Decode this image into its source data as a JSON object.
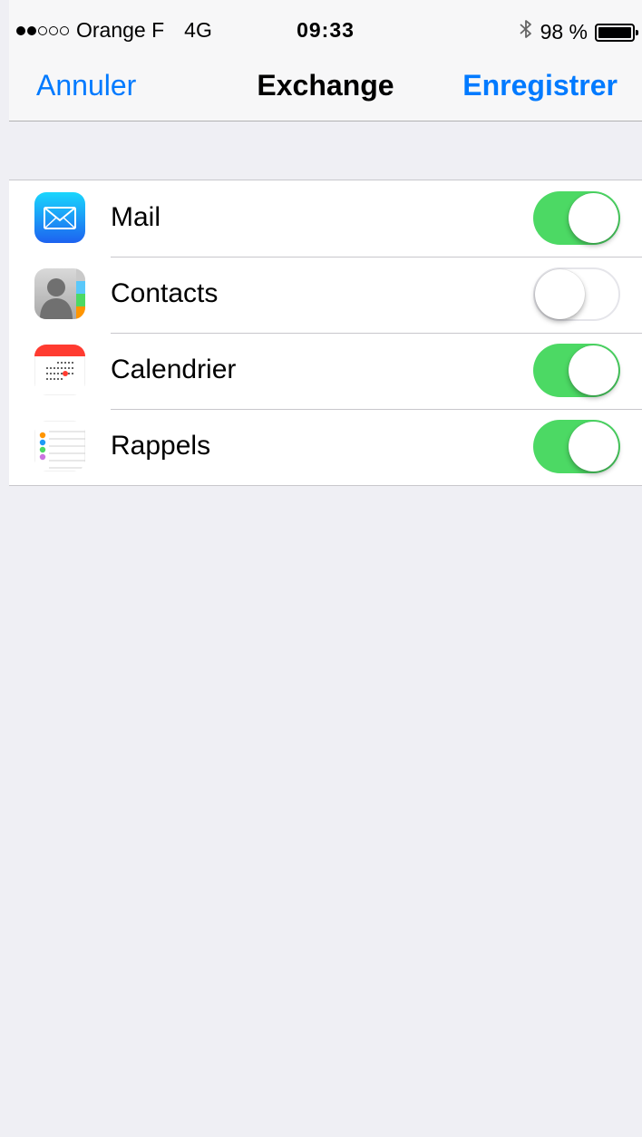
{
  "status_bar": {
    "signal_filled": 2,
    "signal_total": 5,
    "carrier": "Orange F",
    "network": "4G",
    "time": "09:33",
    "bluetooth_icon": "bluetooth-icon",
    "battery_text": "98 %",
    "battery_level": 0.98
  },
  "nav": {
    "cancel_label": "Annuler",
    "title": "Exchange",
    "save_label": "Enregistrer"
  },
  "colors": {
    "accent": "#007aff",
    "toggle_on": "#4cd964",
    "background": "#efeff4"
  },
  "items": [
    {
      "label": "Mail",
      "icon": "mail-icon",
      "enabled": true
    },
    {
      "label": "Contacts",
      "icon": "contacts-icon",
      "enabled": false
    },
    {
      "label": "Calendrier",
      "icon": "calendar-icon",
      "enabled": true
    },
    {
      "label": "Rappels",
      "icon": "reminders-icon",
      "enabled": true
    }
  ]
}
